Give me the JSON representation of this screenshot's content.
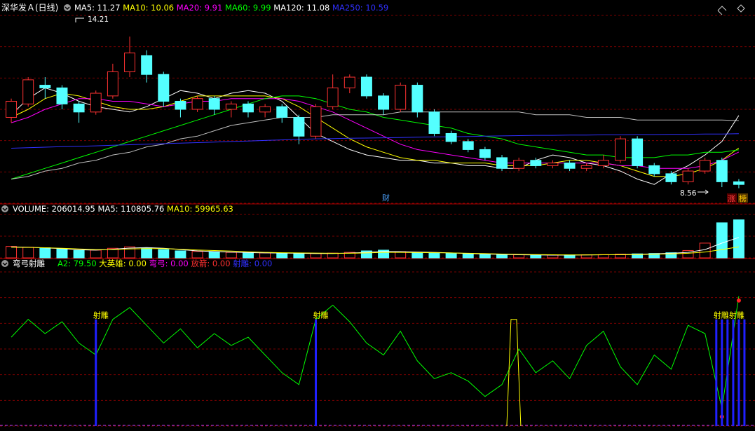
{
  "header": {
    "title": "深华发Ａ(日线)",
    "ma": [
      {
        "label": "MA5: 11.27",
        "color": "#ffffff"
      },
      {
        "label": "MA10: 10.06",
        "color": "#ffff00"
      },
      {
        "label": "MA20: 9.91",
        "color": "#ff00ff"
      },
      {
        "label": "MA60: 9.99",
        "color": "#00ff00"
      },
      {
        "label": "MA120: 11.08",
        "color": "#ffffff"
      },
      {
        "label": "MA250: 10.59",
        "color": "#3030ff"
      }
    ]
  },
  "volume_header": {
    "items": [
      {
        "label": "VOLUME: 206014.95",
        "color": "#ffffff"
      },
      {
        "label": "MA5: 110805.76",
        "color": "#ffffff"
      },
      {
        "label": "MA10: 59965.63",
        "color": "#ffff00"
      }
    ]
  },
  "indicator_header": {
    "title": "弯弓射雕",
    "items": [
      {
        "label": "A2: 79.50",
        "color": "#00ff00"
      },
      {
        "label": "大英雄: 0.00",
        "color": "#ffff00"
      },
      {
        "label": "弯弓: 0.00",
        "color": "#ff00ff"
      },
      {
        "label": "放箭: 0.00",
        "color": "#ff3030"
      },
      {
        "label": "射雕: 0.00",
        "color": "#3030ff"
      }
    ]
  },
  "annotations": {
    "high_label": "14.21",
    "low_label": "8.56",
    "cai_label": "财",
    "zhang_label": "涨",
    "bang_label": "榜",
    "shediao_label": "射雕",
    "shediao_multi_label": "射雕射雕"
  },
  "colors": {
    "up": "#ff3232",
    "down": "#54ffff",
    "grid": "#7a0000",
    "border": "#aa0000",
    "ma5": "#ffffff",
    "ma10": "#ffff00",
    "ma20": "#ff00ff",
    "ma60": "#00ff00",
    "ma120": "#ffffff",
    "ma250": "#3030ff",
    "a2": "#00ff00",
    "shediao": "#2020ff",
    "dayingxiong": "#ffff00",
    "signal_text": "#ffff00"
  },
  "chart_data": [
    {
      "type": "candlestick",
      "title": "深华发Ａ(日线)",
      "y_range": [
        8.0,
        15.0
      ],
      "high": 14.21,
      "low": 8.56,
      "series": [
        {
          "name": "MA5",
          "values": [
            11.3,
            11.9,
            12.3,
            12.1,
            11.8,
            11.6,
            11.5,
            11.4,
            11.6,
            11.9,
            12.2,
            12.1,
            11.9,
            12.1,
            12.2,
            12.1,
            11.8,
            11.2,
            10.6,
            10.3,
            10.0,
            9.8,
            9.7,
            9.6,
            9.6,
            9.5,
            9.5,
            9.4,
            9.4,
            9.3,
            9.3,
            9.6,
            9.8,
            9.7,
            9.5,
            9.4,
            9.2,
            8.9,
            8.7,
            9.1,
            9.4,
            9.8,
            10.3,
            11.27
          ]
        },
        {
          "name": "MA10",
          "values": [
            11.2,
            11.5,
            11.9,
            12.1,
            12.0,
            11.8,
            11.6,
            11.5,
            11.5,
            11.6,
            11.8,
            12.0,
            12.0,
            12.0,
            12.0,
            12.0,
            11.9,
            11.6,
            11.2,
            10.8,
            10.4,
            10.1,
            9.9,
            9.7,
            9.6,
            9.6,
            9.5,
            9.5,
            9.5,
            9.4,
            9.4,
            9.4,
            9.5,
            9.6,
            9.6,
            9.5,
            9.4,
            9.2,
            9.0,
            9.0,
            9.1,
            9.3,
            9.6,
            10.06
          ]
        },
        {
          "name": "MA20",
          "values": [
            11.0,
            11.2,
            11.5,
            11.7,
            11.9,
            11.9,
            11.8,
            11.8,
            11.7,
            11.6,
            11.7,
            11.8,
            11.8,
            11.9,
            11.9,
            11.9,
            11.9,
            11.8,
            11.6,
            11.4,
            11.1,
            10.8,
            10.5,
            10.2,
            10.0,
            9.9,
            9.8,
            9.7,
            9.6,
            9.5,
            9.5,
            9.5,
            9.5,
            9.5,
            9.5,
            9.5,
            9.4,
            9.4,
            9.3,
            9.3,
            9.3,
            9.4,
            9.6,
            9.91
          ]
        },
        {
          "name": "MA60",
          "values": [
            8.9,
            9.1,
            9.3,
            9.5,
            9.7,
            9.9,
            10.1,
            10.3,
            10.5,
            10.7,
            10.9,
            11.1,
            11.3,
            11.5,
            11.7,
            11.9,
            12.0,
            12.0,
            11.9,
            11.7,
            11.5,
            11.4,
            11.2,
            11.1,
            11.0,
            10.9,
            10.8,
            10.6,
            10.5,
            10.4,
            10.2,
            10.1,
            10.0,
            9.9,
            9.8,
            9.8,
            9.7,
            9.7,
            9.7,
            9.8,
            9.8,
            9.9,
            9.9,
            9.99
          ]
        },
        {
          "name": "MA120",
          "values": [
            8.9,
            9.0,
            9.2,
            9.3,
            9.5,
            9.6,
            9.8,
            9.9,
            10.1,
            10.2,
            10.4,
            10.5,
            10.7,
            10.9,
            11.0,
            11.1,
            11.2,
            11.2,
            11.2,
            11.3,
            11.3,
            11.3,
            11.3,
            11.4,
            11.4,
            11.4,
            11.4,
            11.4,
            11.4,
            11.4,
            11.4,
            11.3,
            11.3,
            11.3,
            11.2,
            11.2,
            11.2,
            11.1,
            11.1,
            11.1,
            11.1,
            11.1,
            11.1,
            11.08
          ]
        },
        {
          "name": "MA250",
          "values": [
            10.05,
            10.07,
            10.09,
            10.11,
            10.12,
            10.14,
            10.16,
            10.18,
            10.2,
            10.22,
            10.24,
            10.26,
            10.28,
            10.3,
            10.32,
            10.34,
            10.36,
            10.38,
            10.4,
            10.41,
            10.42,
            10.43,
            10.44,
            10.45,
            10.46,
            10.47,
            10.48,
            10.49,
            10.5,
            10.51,
            10.52,
            10.53,
            10.53,
            10.54,
            10.54,
            10.55,
            10.55,
            10.56,
            10.56,
            10.57,
            10.57,
            10.58,
            10.58,
            10.59
          ]
        }
      ],
      "candles": [
        [
          11.2,
          11.8,
          11.0,
          11.9
        ],
        [
          11.7,
          12.6,
          11.6,
          12.7
        ],
        [
          12.4,
          12.3,
          11.9,
          12.7
        ],
        [
          12.3,
          11.7,
          11.5,
          12.4
        ],
        [
          11.7,
          11.4,
          11.0,
          11.8
        ],
        [
          11.4,
          12.1,
          11.3,
          12.2
        ],
        [
          12.0,
          12.9,
          11.9,
          13.2
        ],
        [
          12.9,
          13.6,
          12.7,
          14.21
        ],
        [
          13.5,
          12.8,
          12.5,
          13.7
        ],
        [
          12.8,
          11.8,
          11.6,
          12.9
        ],
        [
          11.8,
          11.5,
          11.2,
          11.9
        ],
        [
          11.5,
          11.9,
          11.4,
          12.0
        ],
        [
          11.9,
          11.5,
          11.3,
          12.0
        ],
        [
          11.5,
          11.7,
          11.2,
          11.8
        ],
        [
          11.7,
          11.4,
          11.2,
          11.8
        ],
        [
          11.4,
          11.6,
          11.2,
          11.7
        ],
        [
          11.6,
          11.2,
          11.0,
          11.7
        ],
        [
          11.2,
          10.5,
          10.2,
          11.3
        ],
        [
          10.5,
          11.6,
          10.4,
          11.7
        ],
        [
          11.6,
          12.3,
          11.5,
          12.8
        ],
        [
          12.3,
          12.7,
          12.1,
          12.8
        ],
        [
          12.7,
          12.0,
          11.9,
          12.8
        ],
        [
          12.0,
          11.5,
          11.3,
          12.1
        ],
        [
          11.5,
          12.4,
          11.4,
          12.5
        ],
        [
          12.4,
          11.4,
          11.2,
          12.5
        ],
        [
          11.4,
          10.6,
          10.5,
          11.5
        ],
        [
          10.6,
          10.3,
          10.2,
          10.7
        ],
        [
          10.3,
          10.0,
          9.9,
          10.4
        ],
        [
          10.0,
          9.7,
          9.6,
          10.1
        ],
        [
          9.7,
          9.3,
          9.2,
          9.8
        ],
        [
          9.3,
          9.6,
          9.2,
          9.7
        ],
        [
          9.6,
          9.4,
          9.3,
          9.7
        ],
        [
          9.4,
          9.5,
          9.3,
          9.6
        ],
        [
          9.5,
          9.3,
          9.2,
          9.6
        ],
        [
          9.3,
          9.4,
          9.2,
          9.5
        ],
        [
          9.4,
          9.6,
          9.3,
          9.8
        ],
        [
          9.6,
          10.4,
          9.5,
          10.5
        ],
        [
          10.4,
          9.4,
          9.3,
          10.5
        ],
        [
          9.4,
          9.1,
          9.0,
          9.5
        ],
        [
          9.1,
          8.8,
          8.7,
          9.2
        ],
        [
          8.8,
          9.2,
          8.7,
          9.3
        ],
        [
          9.2,
          9.6,
          9.1,
          9.7
        ],
        [
          9.6,
          8.8,
          8.6,
          9.7
        ],
        [
          8.8,
          8.7,
          8.56,
          8.9
        ]
      ]
    },
    {
      "type": "bar",
      "title": "VOLUME",
      "series": [
        {
          "name": "VOLUME",
          "values": [
            62000,
            58000,
            55000,
            48000,
            40000,
            42000,
            52000,
            60000,
            55000,
            45000,
            38000,
            35000,
            33000,
            30000,
            28000,
            27000,
            26000,
            25000,
            24000,
            26000,
            30000,
            38000,
            42000,
            34000,
            30000,
            28000,
            25000,
            22000,
            20000,
            18000,
            17000,
            16000,
            15000,
            16000,
            17000,
            18000,
            20000,
            22000,
            24000,
            28000,
            40000,
            80000,
            190000,
            206014.95
          ]
        },
        {
          "name": "MA5",
          "values": [
            60000,
            58000,
            54000,
            50000,
            44000,
            42000,
            47000,
            53000,
            56000,
            52000,
            45000,
            38000,
            34000,
            31000,
            29000,
            27000,
            26000,
            25000,
            24000,
            24000,
            26000,
            30000,
            35000,
            34000,
            32000,
            30000,
            27000,
            24000,
            21000,
            19000,
            17000,
            16000,
            15000,
            15000,
            16000,
            17000,
            18000,
            20000,
            22000,
            25000,
            30000,
            45000,
            80000,
            110805.76
          ]
        },
        {
          "name": "MA10",
          "values": [
            58000,
            57000,
            55000,
            52000,
            48000,
            45000,
            45000,
            48000,
            50000,
            50000,
            47000,
            43000,
            40000,
            37000,
            33000,
            30000,
            28000,
            27000,
            26000,
            25000,
            25000,
            27000,
            30000,
            30000,
            29000,
            28000,
            27000,
            25000,
            23000,
            21000,
            19000,
            18000,
            17000,
            16000,
            16000,
            17000,
            17000,
            18000,
            20000,
            22000,
            25000,
            32000,
            45000,
            59965.63
          ]
        }
      ],
      "y_range": [
        0,
        220000
      ]
    },
    {
      "type": "line",
      "title": "弯弓射雕",
      "series": [
        {
          "name": "A2",
          "values": [
            45,
            60,
            48,
            58,
            40,
            30,
            60,
            70,
            55,
            40,
            52,
            36,
            48,
            38,
            45,
            30,
            15,
            5,
            60,
            72,
            58,
            40,
            30,
            50,
            25,
            10,
            15,
            8,
            -5,
            5,
            35,
            15,
            25,
            10,
            38,
            50,
            20,
            5,
            30,
            18,
            55,
            48,
            -15,
            79.5
          ]
        }
      ],
      "signals": {
        "射雕": [
          5,
          18,
          42,
          43
        ],
        "大英雄": [
          30
        ]
      },
      "y_range": [
        -30,
        100
      ]
    }
  ]
}
